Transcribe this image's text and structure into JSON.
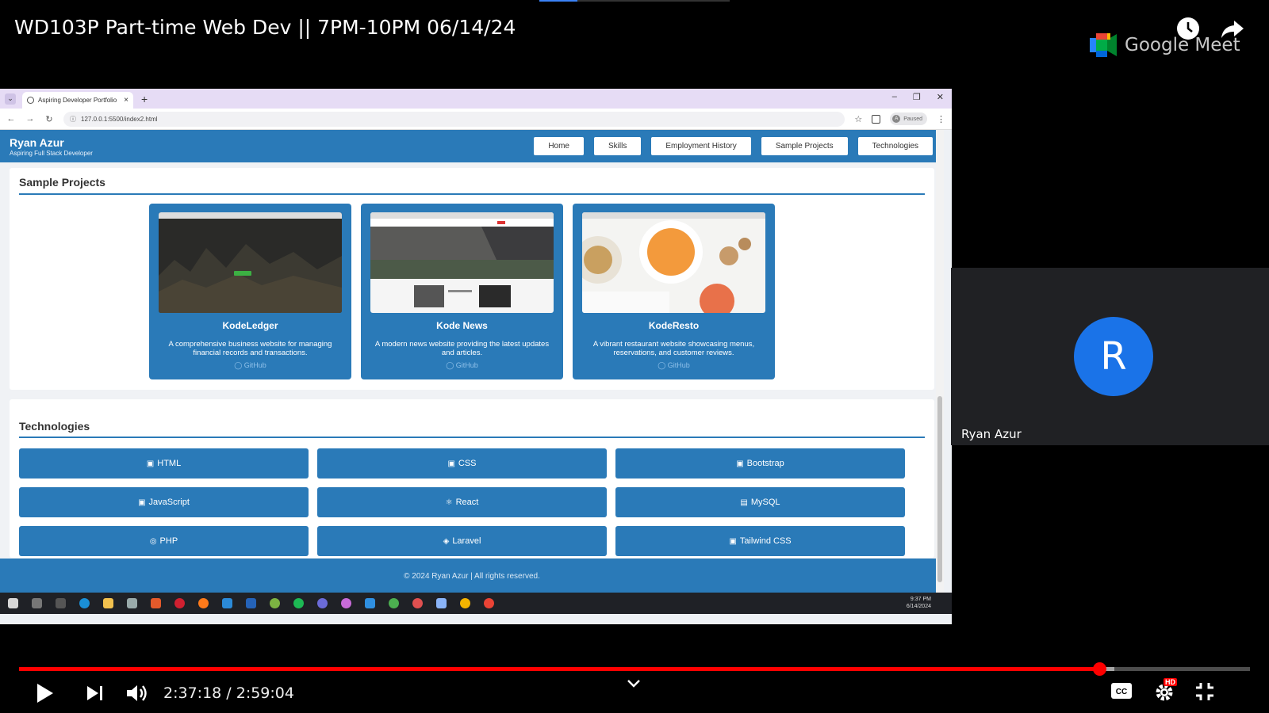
{
  "player": {
    "title": "WD103P Part-time Web Dev || 7PM-10PM 06/14/24",
    "time_current": "2:37:18",
    "time_total": "2:59:04",
    "time_display": "2:37:18 / 2:59:04",
    "progress_played": 0.8778,
    "progress_loaded": 0.89,
    "hd_badge": "HD",
    "colors": {
      "accent": "#ff0000"
    },
    "icons": [
      "watch-later-icon",
      "share-icon",
      "play-icon",
      "next-icon",
      "volume-icon",
      "chevron-down-icon",
      "captions-icon",
      "settings-icon",
      "exit-fullscreen-icon"
    ]
  },
  "meet": {
    "logo_text": "Google Meet",
    "participant": {
      "initial": "R",
      "name": "Ryan Azur",
      "avatar_color": "#1a73e8"
    }
  },
  "browser": {
    "tab_title": "Aspiring Developer Portfolio",
    "url": "127.0.0.1:5500/index2.html",
    "profile_status": "Paused",
    "profile_initial": "A"
  },
  "site": {
    "brand_name": "Ryan Azur",
    "brand_sub": "Aspiring Full Stack Developer",
    "nav": [
      "Home",
      "Skills",
      "Employment History",
      "Sample Projects",
      "Technologies"
    ],
    "projects_title": "Sample Projects",
    "projects": [
      {
        "name": "KodeLedger",
        "desc": "A comprehensive business website for managing financial records and transactions.",
        "link": "GitHub"
      },
      {
        "name": "Kode News",
        "desc": "A modern news website providing the latest updates and articles.",
        "link": "GitHub"
      },
      {
        "name": "KodeResto",
        "desc": "A vibrant restaurant website showcasing menus, reservations, and customer reviews.",
        "link": "GitHub"
      }
    ],
    "tech_title": "Technologies",
    "technologies": [
      "HTML",
      "CSS",
      "Bootstrap",
      "JavaScript",
      "React",
      "MySQL",
      "PHP",
      "Laravel",
      "Tailwind CSS"
    ],
    "footer": "© 2024 Ryan Azur | All rights reserved.",
    "colors": {
      "primary": "#2a7ab8"
    }
  },
  "taskbar": {
    "time": "9:37 PM",
    "date": "6/14/2024"
  }
}
